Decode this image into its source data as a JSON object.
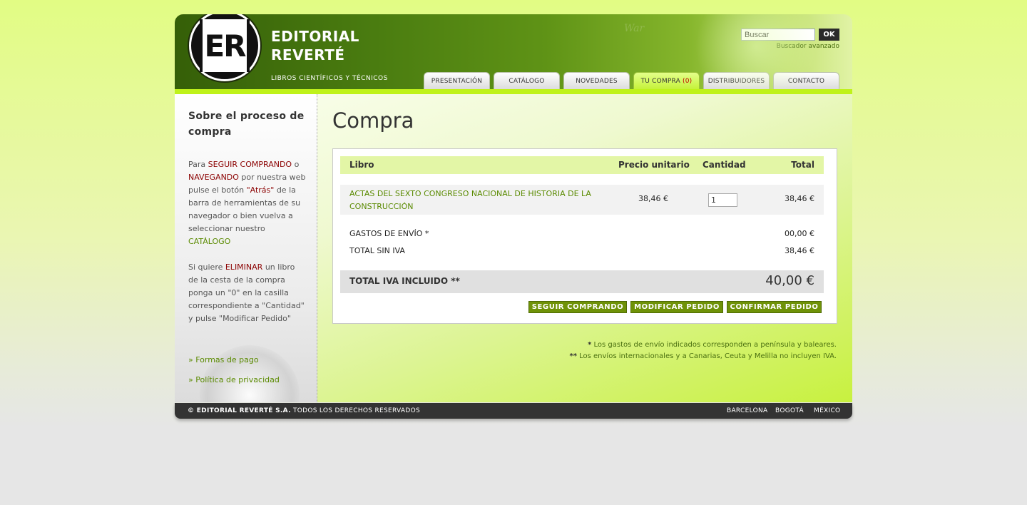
{
  "header": {
    "brand_line1": "EDITORIAL",
    "brand_line2": "REVERTÉ",
    "brand_tagline": "LIBROS CIENTÍFICOS Y TÉCNICOS",
    "logo_text": "ER",
    "search_value": "Buscar",
    "search_button": "OK",
    "advanced_search": "Buscador avanzado"
  },
  "nav": {
    "tabs": [
      {
        "label": "PRESENTACIÓN"
      },
      {
        "label": "CATÁLOGO"
      },
      {
        "label": "NOVEDADES"
      },
      {
        "label": "TU COMPRA",
        "count": "(0)"
      },
      {
        "label": "DISTRIBUIDORES"
      },
      {
        "label": "CONTACTO"
      }
    ],
    "active": "TU COMPRA"
  },
  "sidebar": {
    "title": "Sobre el proceso de compra",
    "p1": {
      "t1": "Para ",
      "link1": "SEGUIR COMPRANDO",
      "t2": " o ",
      "link2": "NAVEGANDO",
      "t3": " por nuestra web pulse el botón ",
      "link3": "\"Atrás\"",
      "t4": " de la barra de herramientas de su navegador o bien vuelva a seleccionar nuestro ",
      "link4": "CATÁLOGO"
    },
    "p2": {
      "t1": "Si quiere ",
      "link1": "ELIMINAR",
      "t2": " un libro de la cesta de la compra ponga un \"0\" en la casilla correspondiente a \"Cantidad\" y pulse \"Modificar Pedido\""
    },
    "links": [
      "» Formas de pago",
      "» Política de privacidad"
    ]
  },
  "main": {
    "title": "Compra",
    "table": {
      "headers": {
        "book": "Libro",
        "unit_price": "Precio unitario",
        "quantity": "Cantidad",
        "total": "Total"
      },
      "rows": [
        {
          "book_line1": "ACTAS DEL SEXTO CONGRESO NACIONAL DE HISTORIA DE LA",
          "book_line2": "CONSTRUCCIÓN",
          "unit_price": "38,46 €",
          "quantity": "1",
          "total": "38,46 €"
        }
      ]
    },
    "summary": {
      "shipping_label": "GASTOS DE ENVÍO *",
      "shipping_value": "00,00 €",
      "subtotal_label": "TOTAL SIN IVA",
      "subtotal_value": "38,46 €",
      "grand_label": "TOTAL IVA INCLUIDO **",
      "grand_value": "40,00 €"
    },
    "buttons": {
      "continue": "SEGUIR COMPRANDO",
      "modify": "MODIFICAR PEDIDO",
      "confirm": "CONFIRMAR PEDIDO"
    },
    "notes": {
      "n1_mark": "*",
      "n1": " Los gastos de envío indicados corresponden a península y baleares.",
      "n2_mark": "**",
      "n2": " Los envíos internacionales y a Canarias, Ceuta y Melilla no incluyen IVA."
    }
  },
  "footer": {
    "copy_bold": "© EDITORIAL REVERTÉ S.A.",
    "copy_rest": " TODOS LOS DERECHOS RESERVADOS",
    "cities": [
      "BARCELONA",
      "BOGOTÁ",
      "MÉXICO"
    ]
  },
  "colors": {
    "accent_green": "#6f9208",
    "nav_active": "#c5f23a",
    "link_red": "#8b0000",
    "footer_bg": "#333333"
  }
}
